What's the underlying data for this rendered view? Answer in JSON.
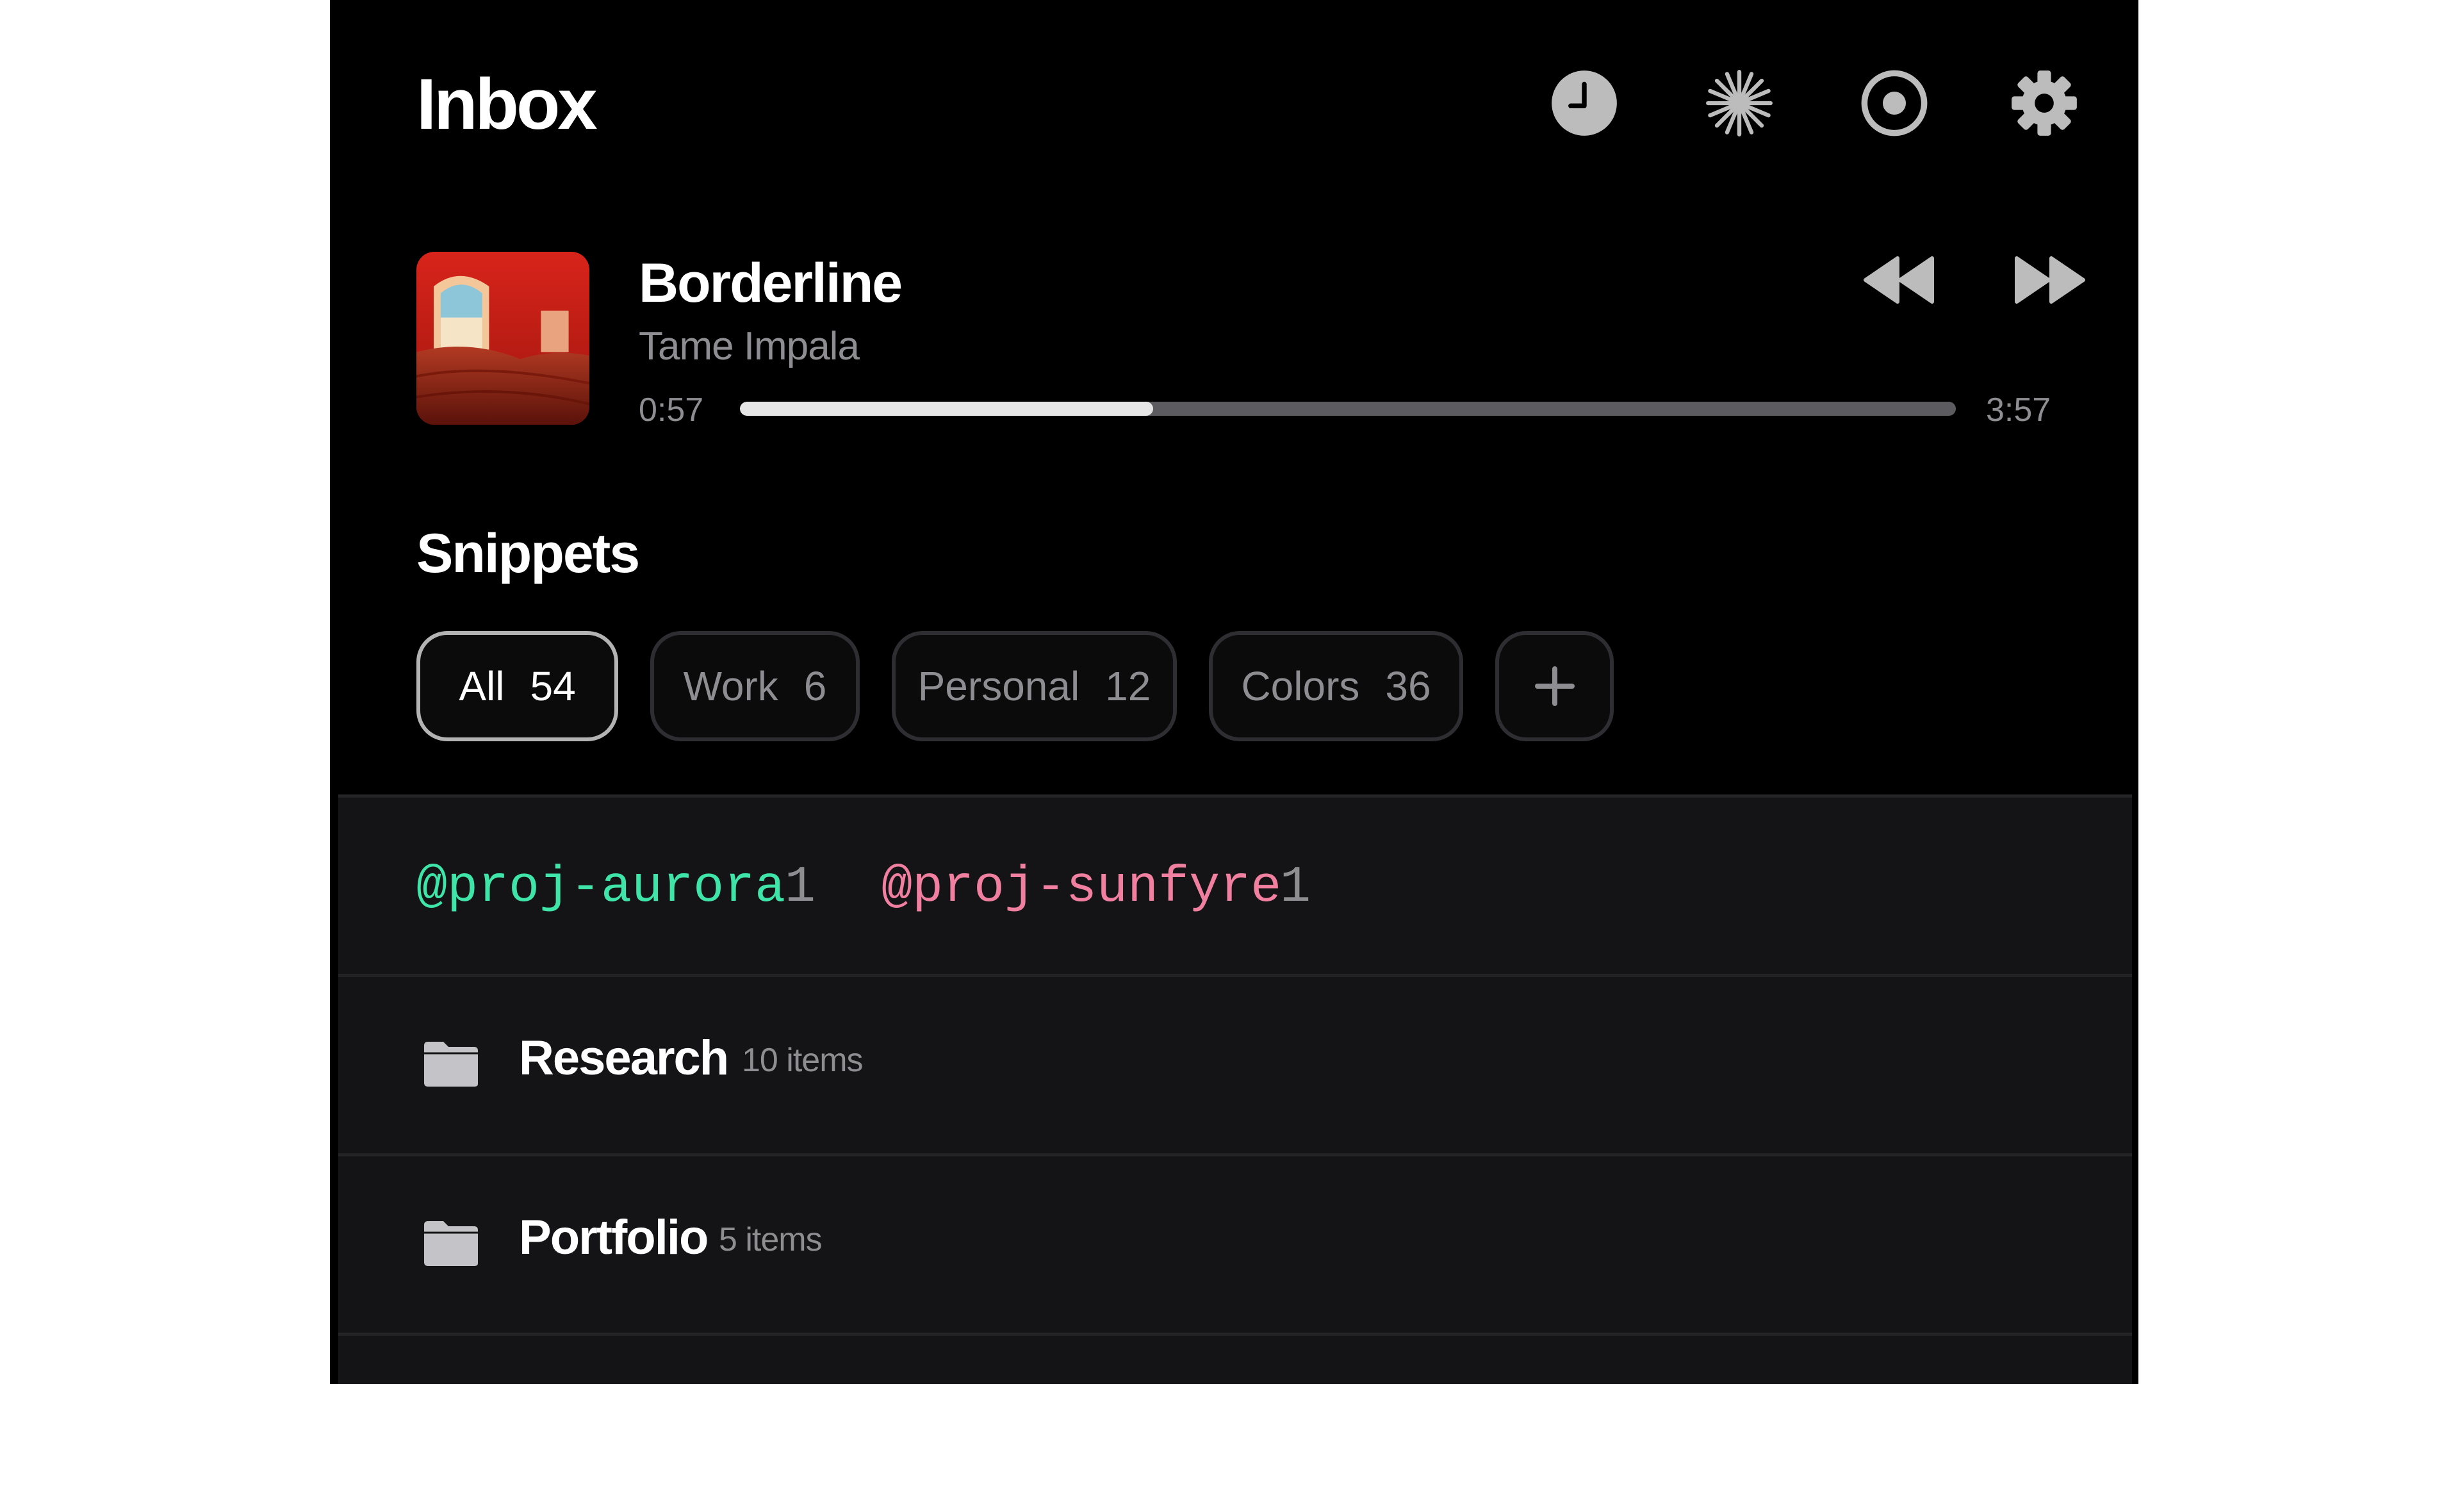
{
  "header": {
    "title": "Inbox",
    "icons": [
      "clock-icon",
      "sparkle-icon",
      "record-icon",
      "gear-icon"
    ]
  },
  "player": {
    "track": "Borderline",
    "artist": "Tame Impala",
    "elapsed": "0:57",
    "duration": "3:57",
    "progress": 0.34
  },
  "snippets": {
    "title": "Snippets",
    "chips": [
      {
        "label": "All",
        "count": "54"
      },
      {
        "label": "Work",
        "count": "6"
      },
      {
        "label": "Personal",
        "count": "12"
      },
      {
        "label": "Colors",
        "count": "36"
      }
    ]
  },
  "tags": [
    {
      "label": "@proj-aurora",
      "count": "1",
      "color": "#3ee4a8"
    },
    {
      "label": "@proj-sunfyre",
      "count": "1",
      "color": "#f07fa0"
    }
  ],
  "folders": [
    {
      "name": "Research",
      "count": "10 items"
    },
    {
      "name": "Portfolio",
      "count": "5 items"
    }
  ],
  "colors": {
    "background": "#000000",
    "panel": "#141416",
    "muted_text": "#8e8e92"
  }
}
